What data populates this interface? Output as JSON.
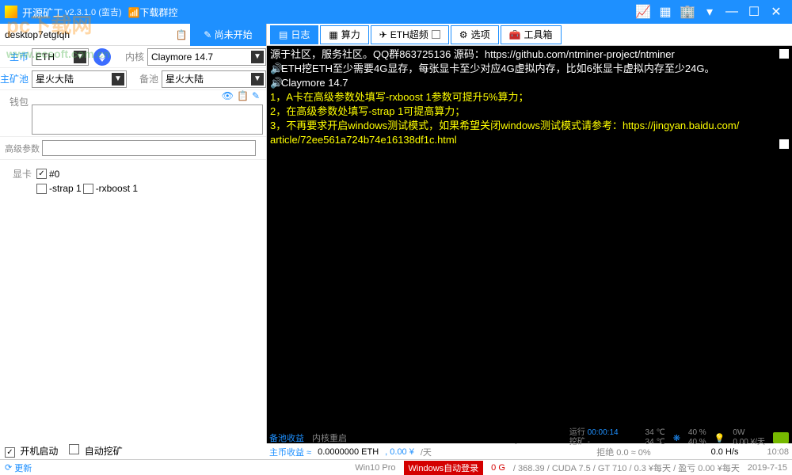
{
  "title": "开源矿工",
  "version": "v2.3.1.0 (蛮吉)",
  "download_link": "下载群控",
  "watermark": {
    "main": "pc下载网",
    "sub": "www.pcsoft.com.cn"
  },
  "workstation": "desktop7etgfqh",
  "start_button": "✎ 尚未开始",
  "labels": {
    "coin": "主币",
    "kernel": "内核",
    "pool": "主矿池",
    "backup": "备池",
    "wallet": "钱包",
    "advanced": "高级参数",
    "gpu": "显卡"
  },
  "coin_value": "ETH",
  "kernel_value": "Claymore 14.7",
  "pool_value": "星火大陆",
  "backup_value": "星火大陆",
  "gpu0": "#0",
  "opt_strap": "-strap 1",
  "opt_rxboost": "-rxboost 1",
  "tabs": {
    "log": "日志",
    "hashrate": "算力",
    "eth_oc": "ETH超频",
    "options": "选项",
    "toolbox": "工具箱"
  },
  "console": {
    "line1": "源于社区，服务社区。QQ群863725136 源码：https://github.com/ntminer-project/ntminer",
    "line2": "ETH挖ETH至少需要4G显存，每张显卡至少对应4G虚拟内存，比如6张显卡虚拟内存至少24G。",
    "line3": "Claymore 14.7",
    "line4": "1，A卡在高级参数处填写-rxboost 1参数可提升5%算力；",
    "line5": "2，在高级参数处填写-strap 1可提高算力；",
    "line6": "3，不再要求开启windows测试模式，如果希望关闭windows测试模式请参考：https://jingyan.baidu.com/",
    "line7": "article/72ee561a724b74e16138df1c.html"
  },
  "bottom": {
    "autostart": "开机启动",
    "automine": "自动挖矿",
    "backup_income": "备池收益",
    "kernel_restart": "内核重启",
    "not_started": "尚未开始",
    "run_lbl": "运行",
    "run_time": "00:00:14",
    "mine_lbl": "挖矿",
    "mine_time": "-",
    "temp1": "34 ℃",
    "temp2": "34 ℃",
    "fan1": "40 %",
    "fan2": "40 %",
    "power1": "0W",
    "power2": "0.00 ¥/天",
    "main_income": "主币收益 ≈",
    "main_val": "0.0000000 ETH",
    "main_yuan": ", 0.00 ¥",
    "per_day": "/天",
    "reject": "拒绝",
    "reject_val": "0.0 ≈ 0%",
    "hashrate": "0.0 H/s",
    "time": "10:08"
  },
  "footer": {
    "update": "更新",
    "os": "Win10 Pro",
    "autologin": "Windows自动登录",
    "gpu_info": "/ 368.39 / CUDA 7.5 / GT 710 / 0.3 ¥每天 / 盈亏 0.00 ¥每天",
    "zero_g": "0 G",
    "date": "2019-7-15"
  }
}
